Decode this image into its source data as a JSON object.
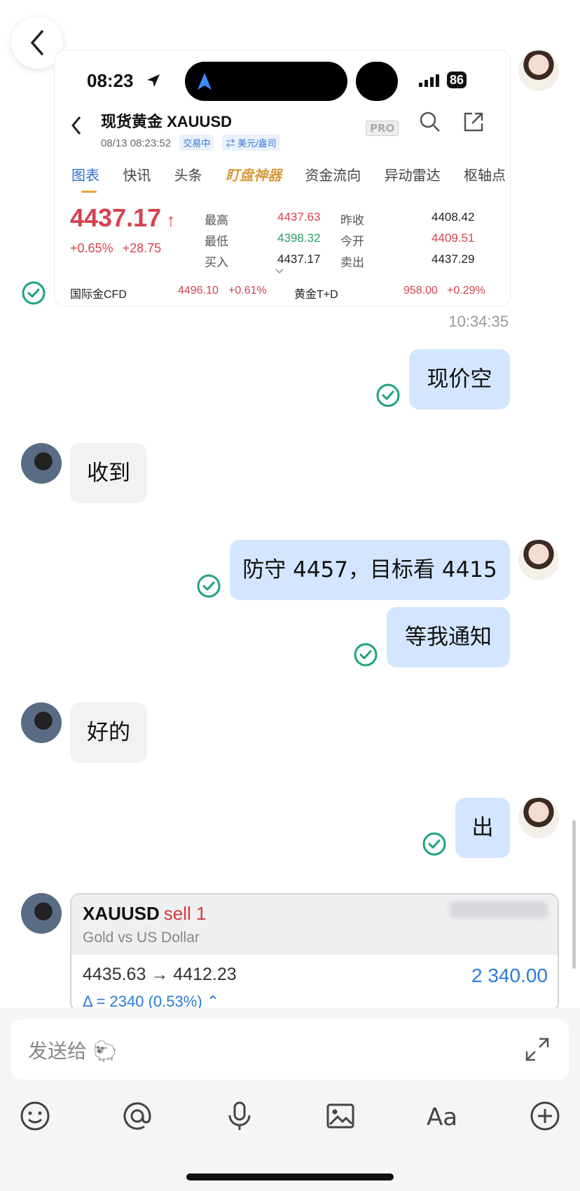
{
  "screenshot_card": {
    "status_time": "08:23",
    "battery": "86",
    "instrument_title": "现货黄金 XAUUSD",
    "timestamp": "08/13 08:23:52",
    "status_tag": "交易中",
    "currency_tag": "⇄ 美元/盎司",
    "pro_label": "PRO",
    "tabs": [
      "图表",
      "快讯",
      "头条",
      "盯盘神器",
      "资金流向",
      "异动雷达",
      "枢轴点"
    ],
    "price": "4437.17",
    "change_pct": "+0.65%",
    "change_abs": "+28.75",
    "quote": {
      "high_label": "最高",
      "high": "4437.63",
      "prev_close_label": "昨收",
      "prev_close": "4408.42",
      "low_label": "最低",
      "low": "4398.32",
      "open_label": "今开",
      "open": "4409.51",
      "bid_label": "买入",
      "bid": "4437.17",
      "ask_label": "卖出",
      "ask": "4437.29"
    },
    "bottom": {
      "cfd_label": "国际金CFD",
      "cfd_value": "4496.10",
      "cfd_change": "+0.61%",
      "td_label": "黄金T+D",
      "td_value": "958.00",
      "td_change": "+0.29%"
    }
  },
  "message_time": "10:34:35",
  "messages": {
    "m1": "现价空",
    "m2": "收到",
    "m3": "防守 4457，目标看 4415",
    "m4": "等我通知",
    "m5": "好的",
    "m6": "出"
  },
  "trade_card": {
    "symbol": "XAUUSD",
    "side": "sell 1",
    "description": "Gold vs US Dollar",
    "prices": "4435.63 → 4412.23",
    "profit": "2 340.00",
    "delta": "Δ = 2340 (0.53%) ⌃"
  },
  "compose": {
    "placeholder": "发送给 🐑"
  },
  "colors": {
    "bubble_me": "#d4e6ff",
    "bubble_peer": "#f1f2f4",
    "price_red": "#d64251",
    "price_green": "#2a9d6a",
    "check_green": "#1fa37a",
    "accent_blue": "#2b7ad8"
  },
  "icons": [
    "back-arrow-icon",
    "check-circle-icon",
    "emoji-icon",
    "mention-icon",
    "microphone-icon",
    "image-icon",
    "font-icon",
    "plus-circle-icon",
    "expand-icon"
  ]
}
